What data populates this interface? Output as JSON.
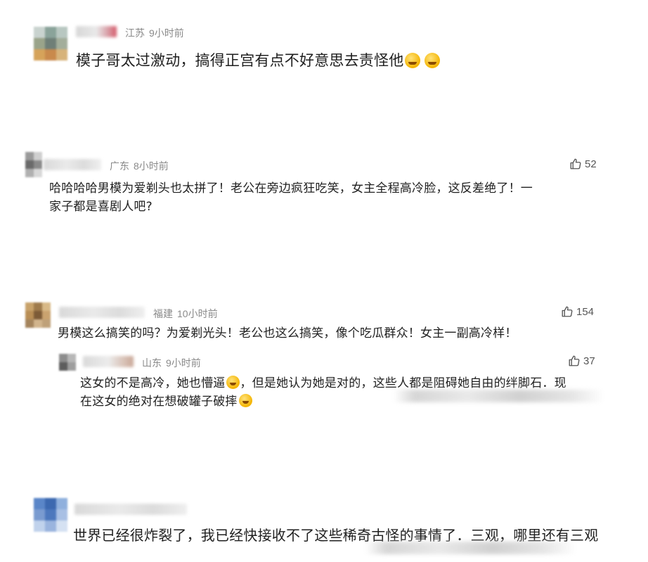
{
  "comments": [
    {
      "location": "江苏",
      "time": "9小时前",
      "text": "模子哥太过激动，搞得正宫有点不好意思去责怪他",
      "emojis": [
        "laugh-cry-emoji",
        "laugh-cry-emoji"
      ]
    },
    {
      "location": "广东",
      "time": "8小时前",
      "likes": "52",
      "text_line1": "哈哈哈哈男模为爱剃头也太拼了！老公在旁边疯狂吃笑，女主全程高冷脸，这反差绝了！一",
      "text_line2": "家子都是喜剧人吧?"
    },
    {
      "location": "福建",
      "time": "10小时前",
      "likes": "154",
      "text": "男模这么搞笑的吗？为爱剃光头！老公也这么搞笑，像个吃瓜群众！女主一副高冷样！",
      "reply": {
        "location": "山东",
        "time": "9小时前",
        "likes": "37",
        "text_line1_a": "这女的不是高冷，她也懵逼",
        "text_line1_b": "，但是她认为她是对的，这些人都是阻碍她自由的绊脚石．现",
        "text_line2": "在这女的绝对在想破罐子破摔",
        "emojis": [
          "dizzy-face-emoji",
          "dizzy-face-emoji"
        ]
      }
    },
    {
      "text": "世界已经很炸裂了，我已经快接收不了这些稀奇古怪的事情了．三观，哪里还有三观"
    }
  ],
  "colors": {
    "meta_text": "#8a8a8a",
    "body_text": "#1f1f1f",
    "like_text": "#555555",
    "background": "#ffffff"
  }
}
